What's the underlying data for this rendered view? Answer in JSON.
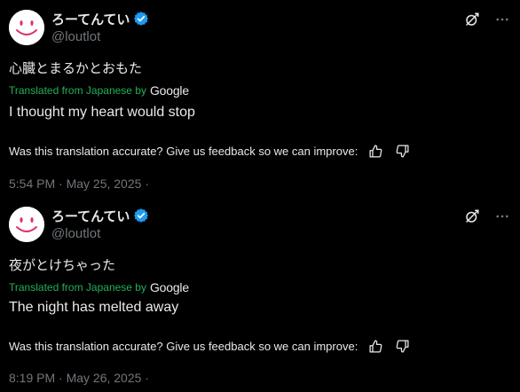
{
  "colors": {
    "background": "#000000",
    "text": "#e7e9ea",
    "secondary_text": "#71767b",
    "translation_green": "#20b259",
    "verified_blue": "#1d9bf0"
  },
  "posts": [
    {
      "author": {
        "display_name": "ろーてんてい",
        "handle": "@loutlot",
        "verified": true
      },
      "original_text": "心臓とまるかとおもた",
      "translation": {
        "label": "Translated from Japanese by",
        "provider": "Google",
        "text": "I thought my heart would stop"
      },
      "feedback": {
        "prompt": "Was this translation accurate? Give us feedback so we can improve:",
        "thumbs_up_icon": "thumbs-up-icon",
        "thumbs_down_icon": "thumbs-down-icon"
      },
      "timestamp": "5:54 PM · May 25, 2025 ·",
      "actions": {
        "grok_icon": "grok-icon",
        "more_icon": "more-icon"
      }
    },
    {
      "author": {
        "display_name": "ろーてんてい",
        "handle": "@loutlot",
        "verified": true
      },
      "original_text": "夜がとけちゃった",
      "translation": {
        "label": "Translated from Japanese by",
        "provider": "Google",
        "text": "The night has melted away"
      },
      "feedback": {
        "prompt": "Was this translation accurate? Give us feedback so we can improve:",
        "thumbs_up_icon": "thumbs-up-icon",
        "thumbs_down_icon": "thumbs-down-icon"
      },
      "timestamp": "8:19 PM · May 26, 2025 ·",
      "actions": {
        "grok_icon": "grok-icon",
        "more_icon": "more-icon"
      }
    }
  ]
}
